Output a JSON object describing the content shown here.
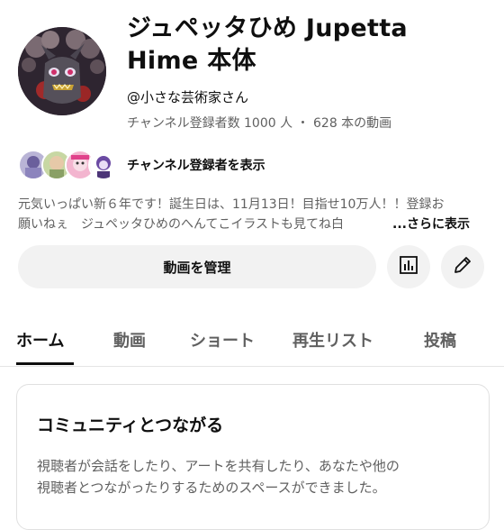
{
  "channel": {
    "title_line1": "ジュペッタひめ  Jupetta",
    "title_line2": "Hime  本体",
    "handle": "@小さな芸術家さん",
    "stats": "チャンネル登録者数 1000 人 ・ 628 本の動画",
    "subscribers_label": "チャンネル登録者を表示",
    "description_line1": "元気いっぱい新６年です！誕生日は、11月13日！目指せ10万人！！登録お",
    "description_line2": "願いねぇ　ジュペッタひめのへんてこイラストも見てね白",
    "more_label": "...さらに表示"
  },
  "actions": {
    "manage_label": "動画を管理",
    "analytics_icon": "analytics-icon",
    "edit_icon": "pencil-icon"
  },
  "tabs": [
    "ホーム",
    "動画",
    "ショート",
    "再生リスト",
    "投稿"
  ],
  "active_tab": 0,
  "community": {
    "title": "コミュニティとつながる",
    "body_line1": "視聴者が会話をしたり、アートを共有したり、あなたや他の",
    "body_line2": "視聴者とつながったりするためのスペースができました。"
  },
  "colors": {
    "text_primary": "#0f0f0f",
    "text_secondary": "#606060",
    "button_bg": "#f2f2f2",
    "divider": "#e5e5e5"
  }
}
